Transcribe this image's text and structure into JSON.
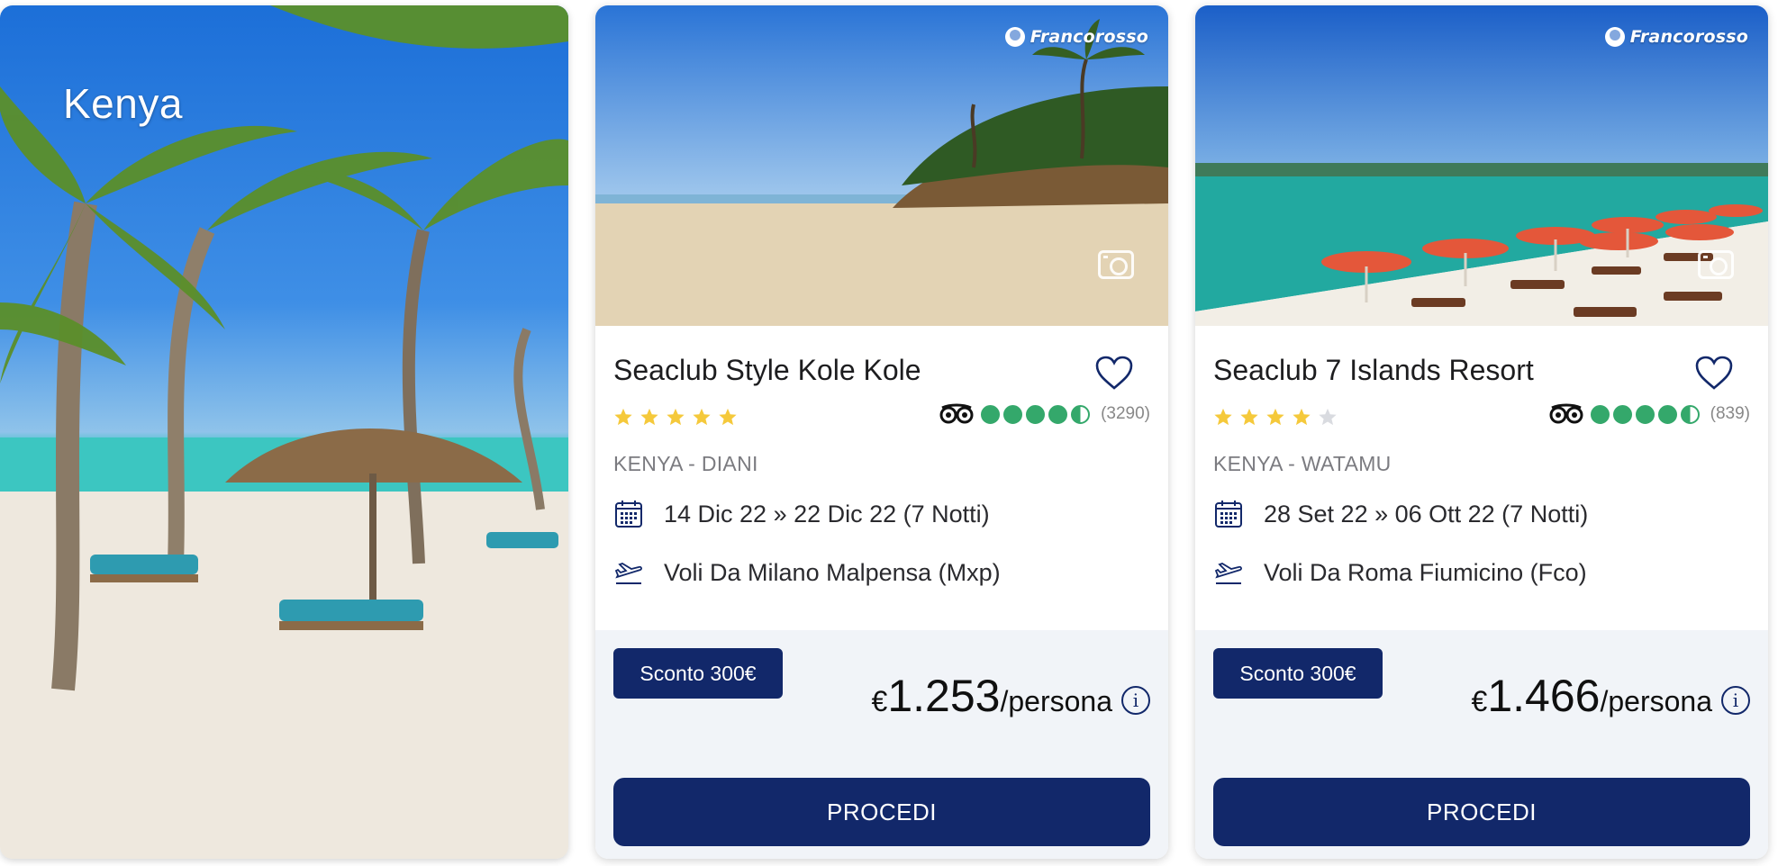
{
  "destination": {
    "title": "Kenya"
  },
  "cards": [
    {
      "brand": "Francorosso",
      "name": "Seaclub Style Kole Kole",
      "stars": 5,
      "tripadvisor": {
        "rating": 4.5,
        "reviews": "(3290)"
      },
      "location": "KENYA - DIANI",
      "dates": "14 Dic 22 » 22 Dic 22 (7 Notti)",
      "flight": "Voli Da Milano Malpensa (Mxp)",
      "discount": "Sconto 300€",
      "currency": "€",
      "price": "1.253",
      "per": "/persona",
      "info": "i",
      "cta": "PROCEDI"
    },
    {
      "brand": "Francorosso",
      "name": "Seaclub 7 Islands Resort",
      "stars": 4,
      "tripadvisor": {
        "rating": 4.5,
        "reviews": "(839)"
      },
      "location": "KENYA - WATAMU",
      "dates": "28 Set 22 » 06 Ott 22 (7 Notti)",
      "flight": "Voli Da Roma Fiumicino (Fco)",
      "discount": "Sconto 300€",
      "currency": "€",
      "price": "1.466",
      "per": "/persona",
      "info": "i",
      "cta": "PROCEDI"
    }
  ],
  "colors": {
    "primary": "#12286a",
    "star": "#f5c93b",
    "tripadvisor_green": "#34a86b",
    "panel": "#f1f4f8"
  }
}
